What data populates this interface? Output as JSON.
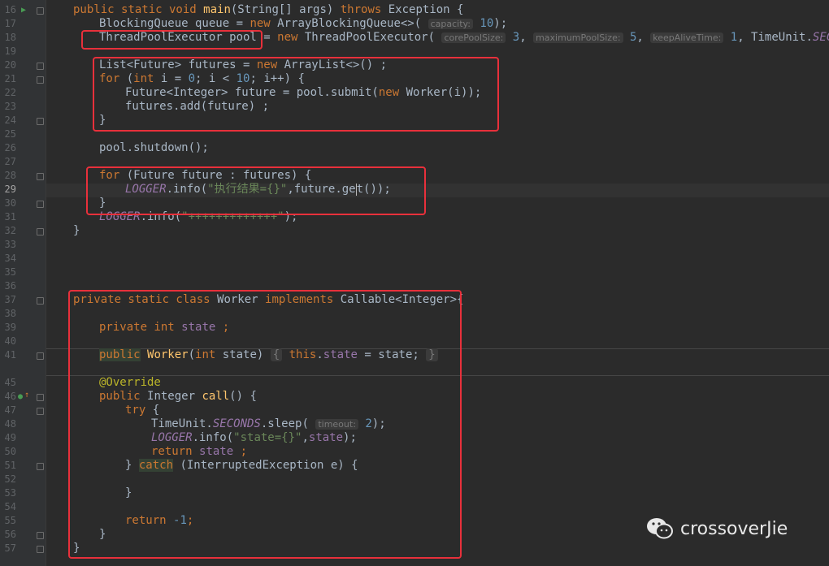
{
  "gutter": {
    "lines": [
      "16",
      "17",
      "18",
      "19",
      "20",
      "21",
      "22",
      "23",
      "24",
      "25",
      "26",
      "27",
      "28",
      "29",
      "30",
      "31",
      "32",
      "33",
      "34",
      "35",
      "36",
      "37",
      "38",
      "39",
      "40",
      "41",
      "45",
      "46",
      "47",
      "48",
      "49",
      "50",
      "51",
      "52",
      "53",
      "54",
      "55",
      "56",
      "57"
    ]
  },
  "code": {
    "l16_kw1": "public static void ",
    "l16_name": "main",
    "l16_mid": "(String[] args) ",
    "l16_kw2": "throws ",
    "l16_end": "Exception {",
    "l17_a": "BlockingQueue queue = ",
    "l17_new": "new ",
    "l17_b": "ArrayBlockingQueue<>(",
    "l17_hint": "capacity:",
    "l17_num": "10",
    "l17_end": ");",
    "l18_a": "ThreadPoolExecutor pool = ",
    "l18_new": "new ",
    "l18_b": "ThreadPoolExecutor(",
    "l18_h1": "corePoolSize:",
    "l18_n1": "3",
    "l18_h2": "maximumPoolSize:",
    "l18_n2": "5",
    "l18_h3": "keepAliveTime:",
    "l18_n3": "1",
    "l18_c": ", TimeUnit.",
    "l18_f": "SECONDS",
    "l20_a": "List<Future> futures = ",
    "l20_new": "new ",
    "l20_b": "ArrayList<>() ;",
    "l21_for": "for ",
    "l21_a": "(",
    "l21_int": "int ",
    "l21_b": "i = ",
    "l21_n0": "0",
    "l21_c": "; i < ",
    "l21_n10": "10",
    "l21_d": "; i++) {",
    "l22_a": "Future<Integer> future = pool.submit(",
    "l22_new": "new ",
    "l22_b": "Worker(i));",
    "l23": "futures.add(future) ;",
    "l24": "}",
    "l26": "pool.shutdown();",
    "l28_for": "for ",
    "l28_b": "(Future future : futures) {",
    "l29_logger": "LOGGER",
    "l29_a": ".info(",
    "l29_str": "\"执行结果={}\"",
    "l29_b": ",future.ge",
    "l29_c": "t());",
    "l30": "}",
    "l31_logger": "LOGGER",
    "l31_a": ".info(",
    "l31_str": "\"+++++++++++++\"",
    "l31_b": ");",
    "l32": "}",
    "l37_kw": "private static class ",
    "l37_a": "Worker ",
    "l37_impl": "implements ",
    "l37_b": "Callable<Integer>{",
    "l39_kw": "private int ",
    "l39_fld": "state",
    "l39_end": " ;",
    "l41_pub": "public",
    "l41_sp": " ",
    "l41_name": "Worker",
    "l41_a": "(",
    "l41_int": "int ",
    "l41_b": "state) ",
    "l41_ob": "{",
    "l41_this": " this",
    "l41_dot": ".",
    "l41_fld": "state",
    "l41_c": " = state; ",
    "l41_cb": "}",
    "l45": "@Override",
    "l46_pub": "public ",
    "l46_a": "Integer ",
    "l46_name": "call",
    "l46_b": "() {",
    "l47_try": "try ",
    "l47_b": "{",
    "l48_a": "TimeUnit.",
    "l48_f": "SECONDS",
    "l48_b": ".sleep(",
    "l48_hint": "timeout:",
    "l48_n": "2",
    "l48_c": ");",
    "l49_logger": "LOGGER",
    "l49_a": ".info(",
    "l49_str": "\"state={}\"",
    "l49_b": ",",
    "l49_fld": "state",
    "l49_c": ");",
    "l50_ret": "return ",
    "l50_fld": "state",
    "l50_end": " ;",
    "l51_a": "} ",
    "l51_catch": "catch",
    "l51_b": " (InterruptedException e) {",
    "l53": "}",
    "l55_ret": "return ",
    "l55_n": "-1",
    "l55_end": ";",
    "l56": "}",
    "l57": "}"
  },
  "watermark": {
    "text": "crossoverJie"
  },
  "colors": {
    "highlight_box": "#e8303b",
    "keyword": "#cc7832",
    "method": "#ffc66d",
    "number": "#6897bb",
    "string": "#6a8759",
    "field": "#9876aa",
    "annotation": "#bbb529"
  }
}
